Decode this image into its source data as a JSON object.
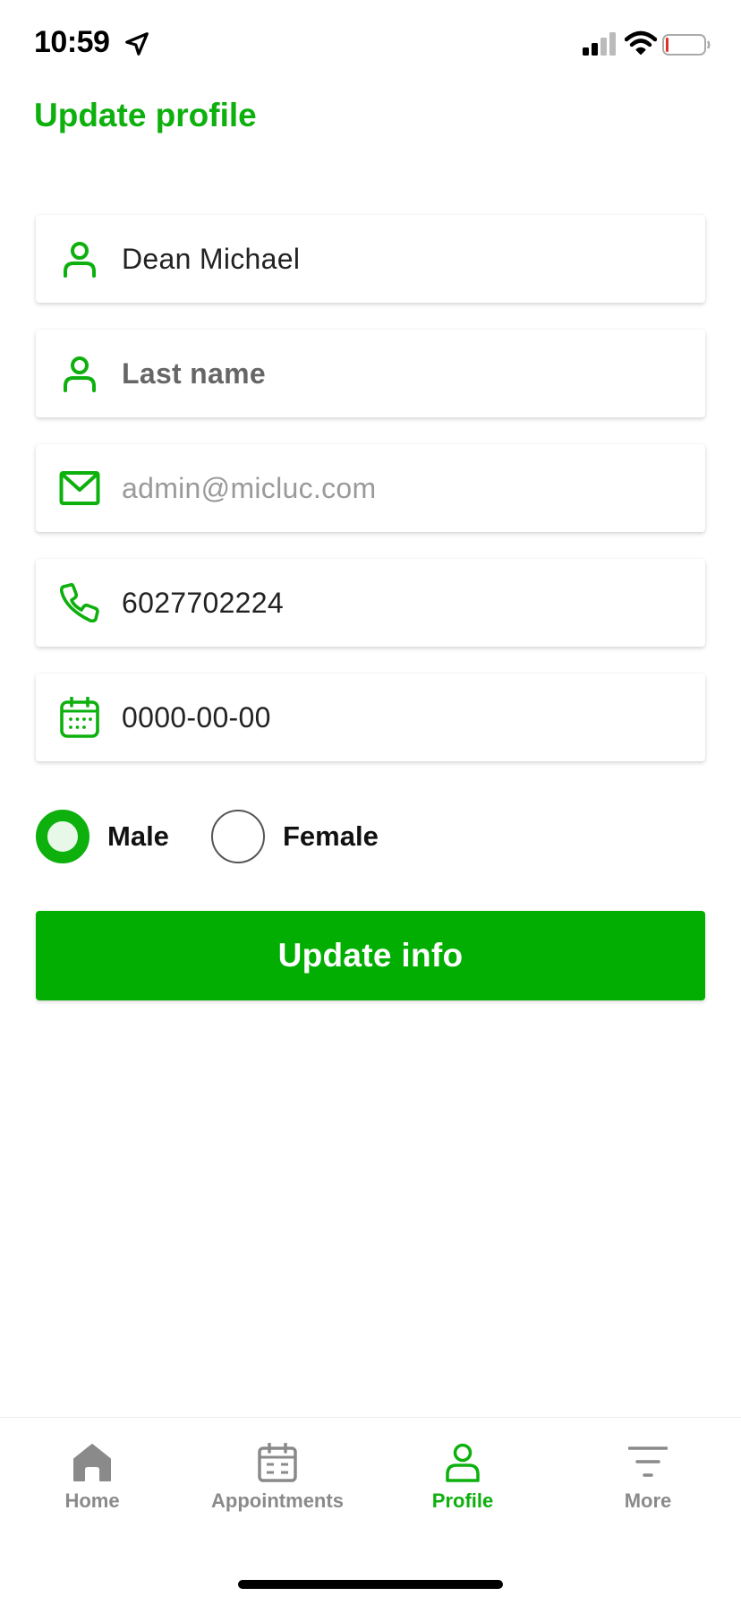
{
  "status_bar": {
    "time": "10:59",
    "location_icon": "location-arrow-icon",
    "signal_icon": "cellular-signal-icon",
    "wifi_icon": "wifi-icon",
    "battery_icon": "battery-low-icon"
  },
  "page": {
    "title": "Update profile"
  },
  "colors": {
    "accent": "#0db00d",
    "button": "#02ae02",
    "inactive": "#8a8a8a"
  },
  "form": {
    "first_name": {
      "value": "Dean Michael",
      "icon": "person-icon"
    },
    "last_name": {
      "placeholder": "Last name",
      "icon": "person-icon"
    },
    "email": {
      "value": "admin@micluc.com",
      "icon": "envelope-icon"
    },
    "phone": {
      "value": "6027702224",
      "icon": "phone-icon"
    },
    "dob": {
      "value": "0000-00-00",
      "icon": "calendar-icon"
    },
    "gender": {
      "options": [
        "Male",
        "Female"
      ],
      "selected": "Male"
    },
    "submit_label": "Update info"
  },
  "tab_bar": {
    "items": [
      {
        "label": "Home",
        "icon": "home-icon",
        "active": false
      },
      {
        "label": "Appointments",
        "icon": "calendar-icon",
        "active": false
      },
      {
        "label": "Profile",
        "icon": "person-icon",
        "active": true
      },
      {
        "label": "More",
        "icon": "filter-menu-icon",
        "active": false
      }
    ]
  }
}
